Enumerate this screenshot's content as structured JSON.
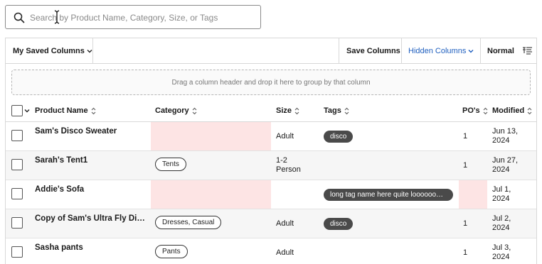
{
  "search": {
    "placeholder": "Search by Product Name, Category, Size, or Tags",
    "value": ""
  },
  "toolbar": {
    "saved_columns": "My Saved Columns",
    "save_columns": "Save Columns",
    "hidden_columns": "Hidden Columns",
    "density": "Normal",
    "accent_color": "#1f5fbf"
  },
  "group_hint": "Drag a column header and drop it here to group by that column",
  "columns": [
    "Product Name",
    "Category",
    "Size",
    "Tags",
    "PO's",
    "Modified"
  ],
  "rows": [
    {
      "name": "Sam's Disco Sweater",
      "category": "",
      "size": "Adult",
      "tag": "disco",
      "pos": "1",
      "modified": [
        "Jun 13,",
        "2024"
      ]
    },
    {
      "name": "Sarah's Tent1",
      "category": "Tents",
      "size": [
        "1-2",
        "Person"
      ],
      "tag": "",
      "pos": "1",
      "modified": [
        "Jun 27,",
        "2024"
      ]
    },
    {
      "name": "Addie's Sofa",
      "category": "",
      "size": "",
      "tag": "long tag name here quite looooooooong",
      "pos": "",
      "modified": [
        "Jul 1,",
        "2024"
      ]
    },
    {
      "name": "Copy of Sam's Ultra Fly Disco Sweater",
      "category": "Dresses, Casual",
      "size": "Adult",
      "tag": "disco",
      "pos": "1",
      "modified": [
        "Jul 2,",
        "2024"
      ]
    },
    {
      "name": "Sasha pants",
      "category": "Pants",
      "size": "Adult",
      "tag": "",
      "pos": "1",
      "modified": [
        "Jul 3,",
        "2024"
      ]
    }
  ],
  "colors": {
    "missing_value": "#fde4e4",
    "tag_dark": "#4a4a4a"
  }
}
